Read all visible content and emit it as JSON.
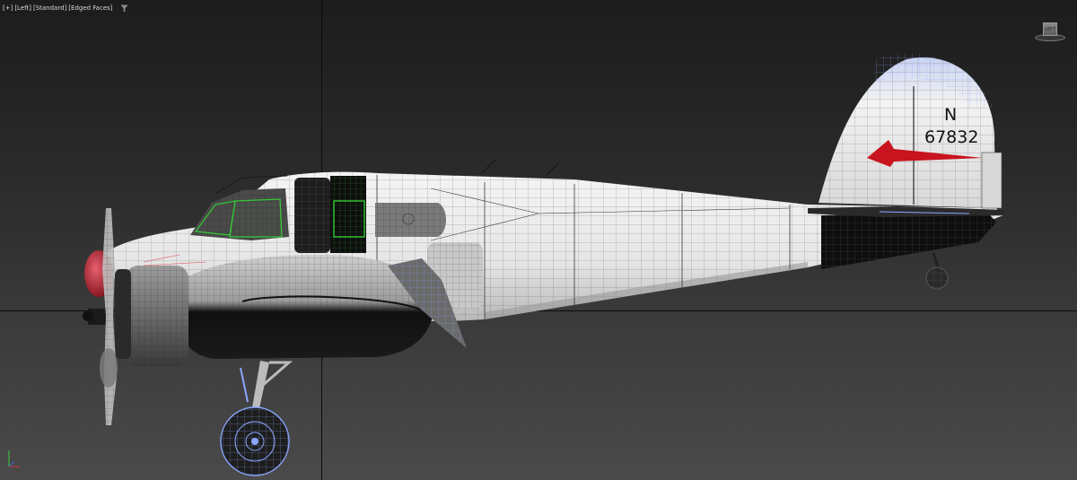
{
  "viewport": {
    "label_items": [
      "[+]",
      "[Left]",
      "[Standard]",
      "[Edged Faces]"
    ],
    "label_separator": " ",
    "filter_icon": "funnel-icon",
    "background_top": "#1c1c1c",
    "background_bottom": "#4a4a4a"
  },
  "viewcube": {
    "face_label": "LEFT",
    "icon": "viewcube-icon"
  },
  "axis_tripod": {
    "icon": "axis-tripod-icon",
    "x_color": "#cc3a3a",
    "y_color": "#3acc3a",
    "z_color": "#3a6acc"
  },
  "model": {
    "registration_prefix": "N",
    "registration_number": "67832",
    "livery_arrow_color": "#c8141e",
    "spinner_color": "#b01820",
    "wire_selection_color": "#33cc33",
    "wire_color_light": "#1a1a1a",
    "wire_color_dark": "#8aa6ff"
  }
}
